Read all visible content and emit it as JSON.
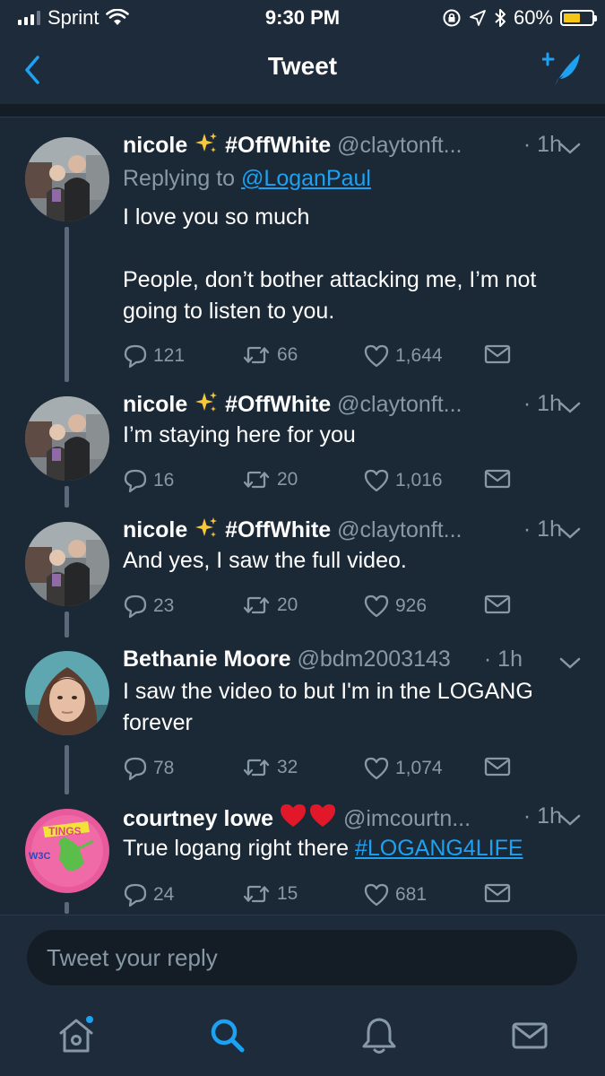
{
  "status_bar": {
    "carrier": "Sprint",
    "time": "9:30 PM",
    "battery_percent": "60%",
    "battery_level": 0.6,
    "signal_bars": 3
  },
  "nav": {
    "title": "Tweet",
    "back_icon": "chevron-left-icon",
    "compose_icon": "compose-feather-icon"
  },
  "tweets": [
    {
      "name": "nicole",
      "name_suffix": "#OffWhite",
      "handle": "@claytonft...",
      "time": "· 1h",
      "replying_label": "Replying to",
      "replying_to": "@LoganPaul",
      "text": "I love you so much\n\nPeople, don’t bother attacking me, I’m not going to listen to you.",
      "replies": "121",
      "retweets": "66",
      "likes": "1,644"
    },
    {
      "name": "nicole",
      "name_suffix": "#OffWhite",
      "handle": "@claytonft...",
      "time": "· 1h",
      "text": "I’m staying here for you",
      "replies": "16",
      "retweets": "20",
      "likes": "1,016"
    },
    {
      "name": "nicole",
      "name_suffix": "#OffWhite",
      "handle": "@claytonft...",
      "time": "· 1h",
      "text": "And yes, I saw the full video.",
      "replies": "23",
      "retweets": "20",
      "likes": "926"
    },
    {
      "name": "Bethanie Moore",
      "handle": "@bdm2003143",
      "time": "· 1h",
      "text": "I saw the video to but I'm in the LOGANG forever",
      "replies": "78",
      "retweets": "32",
      "likes": "1,074"
    },
    {
      "name": "courtney lowe",
      "handle": "@imcourtn...",
      "time": "· 1h",
      "text_prefix": "True logang right there ",
      "hashtag": "#LOGANG4LIFE",
      "replies": "24",
      "retweets": "15",
      "likes": "681"
    }
  ],
  "reply_bar": {
    "placeholder": "Tweet your reply"
  },
  "tabbar": {
    "items": [
      "home-icon",
      "search-icon",
      "notifications-bell-icon",
      "messages-envelope-icon"
    ],
    "active": "search-icon",
    "accent": "#1da1f2"
  },
  "colors": {
    "background": "#1b2836",
    "bar": "#1e2b3a",
    "accent": "#1da1f2",
    "secondary_text": "#8899a6"
  }
}
